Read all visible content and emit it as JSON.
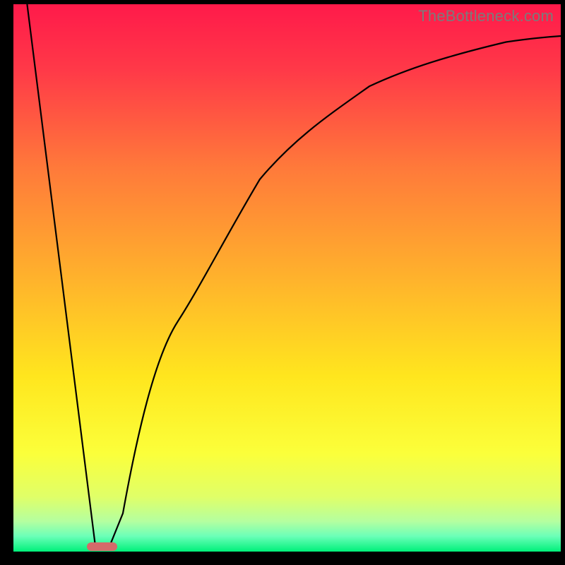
{
  "watermark": "TheBottleneck.com",
  "chart_data": {
    "type": "line",
    "title": "",
    "xlabel": "",
    "ylabel": "",
    "xlim": [
      0,
      100
    ],
    "ylim": [
      0,
      100
    ],
    "background": {
      "type": "vertical-gradient",
      "stops": [
        {
          "pos": 0.0,
          "color": "#ff1a4a"
        },
        {
          "pos": 0.12,
          "color": "#ff3948"
        },
        {
          "pos": 0.3,
          "color": "#ff7a3a"
        },
        {
          "pos": 0.5,
          "color": "#ffb22c"
        },
        {
          "pos": 0.68,
          "color": "#ffe61e"
        },
        {
          "pos": 0.82,
          "color": "#fbff3a"
        },
        {
          "pos": 0.9,
          "color": "#e0ff68"
        },
        {
          "pos": 0.945,
          "color": "#b4ffa0"
        },
        {
          "pos": 0.972,
          "color": "#6bffb8"
        },
        {
          "pos": 1.0,
          "color": "#00f07a"
        }
      ]
    },
    "marker": {
      "shape": "capsule",
      "x": 16.0,
      "y": 0.8,
      "width": 5.5,
      "height": 1.6,
      "color": "#d46a6a"
    },
    "series": [
      {
        "name": "bottleneck-curve",
        "segments": [
          {
            "type": "line",
            "from": {
              "x": 2.5,
              "y": 100
            },
            "to": {
              "x": 15.0,
              "y": 0.8
            }
          },
          {
            "type": "curve",
            "points": [
              {
                "x": 17.5,
                "y": 0.8
              },
              {
                "x": 20.0,
                "y": 7.0
              },
              {
                "x": 25.0,
                "y": 26.0
              },
              {
                "x": 30.0,
                "y": 42.0
              },
              {
                "x": 35.0,
                "y": 55.0
              },
              {
                "x": 40.0,
                "y": 65.0
              },
              {
                "x": 45.0,
                "y": 72.5
              },
              {
                "x": 50.0,
                "y": 78.0
              },
              {
                "x": 55.0,
                "y": 82.0
              },
              {
                "x": 60.0,
                "y": 85.0
              },
              {
                "x": 65.0,
                "y": 87.2
              },
              {
                "x": 70.0,
                "y": 89.0
              },
              {
                "x": 75.0,
                "y": 90.4
              },
              {
                "x": 80.0,
                "y": 91.5
              },
              {
                "x": 85.0,
                "y": 92.4
              },
              {
                "x": 90.0,
                "y": 93.1
              },
              {
                "x": 95.0,
                "y": 93.7
              },
              {
                "x": 100.0,
                "y": 94.2
              }
            ]
          }
        ]
      }
    ]
  }
}
